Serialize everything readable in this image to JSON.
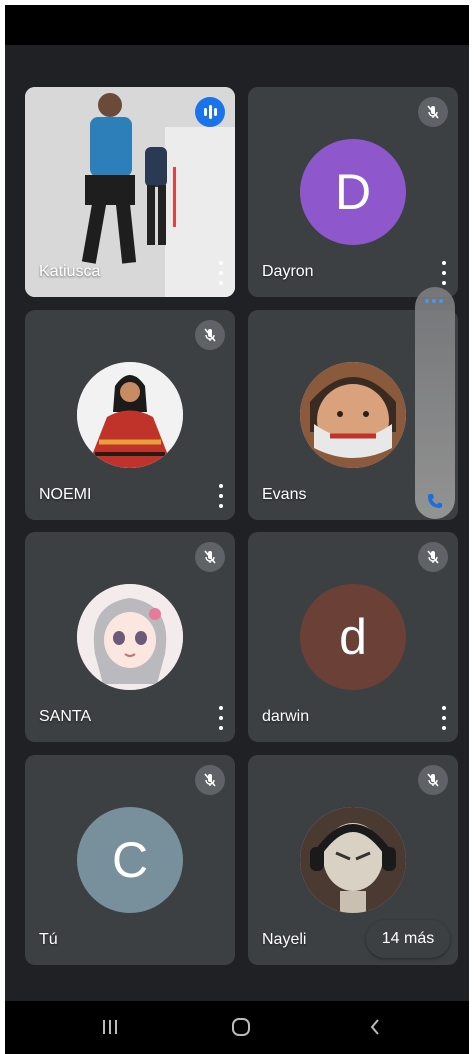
{
  "participants": [
    {
      "name": "Katiusca",
      "type": "video"
    },
    {
      "name": "Dayron",
      "initial": "D",
      "color": "#8e57cc"
    },
    {
      "name": "NOEMI",
      "type": "photo"
    },
    {
      "name": "Evans",
      "type": "photo"
    },
    {
      "name": "SANTA",
      "type": "photo"
    },
    {
      "name": "darwin",
      "initial": "d",
      "color": "#6b4037"
    },
    {
      "name": "Tú",
      "initial": "C",
      "color": "#78909c"
    },
    {
      "name": "Nayeli",
      "type": "photo"
    }
  ],
  "overflow_badge": "14 más",
  "icons": {
    "mute": "mic-off-icon",
    "speaking": "audio-level-icon",
    "more": "more-vert-icon",
    "panel_menu": "more-horiz-icon",
    "panel_call": "phone-icon",
    "nav_recent": "recent-apps-icon",
    "nav_home": "home-icon",
    "nav_back": "back-icon"
  },
  "colors": {
    "background": "#202124",
    "tile": "#3c4043",
    "accent": "#1a73e8"
  }
}
